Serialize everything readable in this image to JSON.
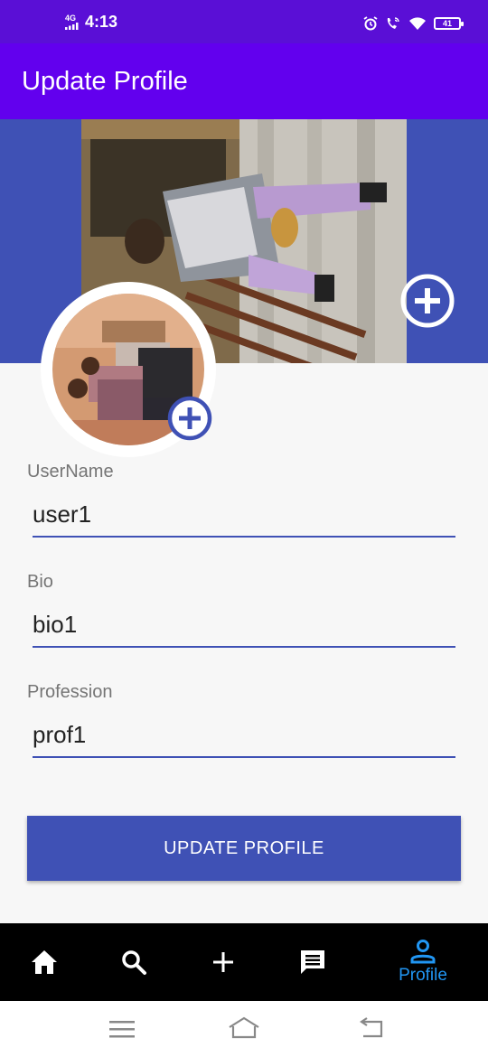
{
  "status_bar": {
    "network": "4G",
    "time": "4:13",
    "battery": "41",
    "icons": [
      "signal-icon",
      "alarm-icon",
      "call-icon",
      "wifi-icon",
      "battery-icon"
    ]
  },
  "app_bar": {
    "title": "Update Profile"
  },
  "cover": {
    "add_icon": "add-circle-icon"
  },
  "avatar": {
    "add_icon": "add-circle-icon"
  },
  "form": {
    "username_label": "UserName",
    "username_value": "user1",
    "bio_label": "Bio",
    "bio_value": "bio1",
    "profession_label": "Profession",
    "profession_value": "prof1"
  },
  "update_button": "UPDATE PROFILE",
  "bottom_nav": {
    "items": [
      {
        "icon": "home-icon"
      },
      {
        "icon": "search-icon"
      },
      {
        "icon": "add-icon"
      },
      {
        "icon": "chat-icon"
      },
      {
        "icon": "person-icon",
        "label": "Profile"
      }
    ]
  },
  "colors": {
    "status_bar": "#5a0fd6",
    "app_bar": "#6200ee",
    "primary": "#3f51b5",
    "nav_active": "#2196f3"
  }
}
